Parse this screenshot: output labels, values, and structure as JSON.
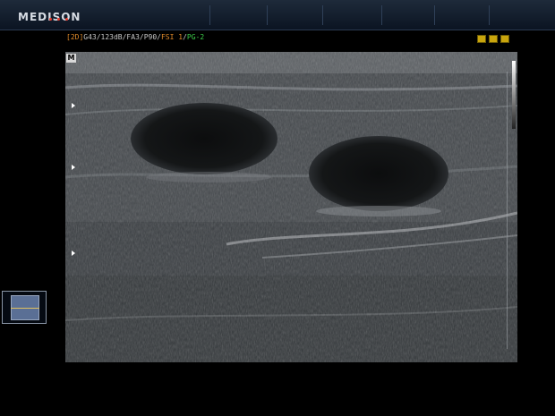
{
  "header": {
    "brand": "MEDISON",
    "brand_dot_colors": [
      "#e6392b",
      "#e6392b",
      "#e6392b"
    ]
  },
  "params_bar": {
    "mode": "[2D]",
    "settings": "G43/123dB/FA3/P90/",
    "fsi": "FSI 1",
    "slash": "/",
    "pg": "PG-2",
    "colors": {
      "mode": "#e08a2a",
      "settings": "#c8c8c8",
      "fsi": "#e08a2a",
      "pg": "#3ccd4a"
    }
  },
  "status_icons": [
    "warning-icon",
    "battery-icon",
    "storage-icon"
  ],
  "image": {
    "marker_label": "M"
  },
  "probe_thumbnail": {
    "icon": "probe-position-icon"
  }
}
